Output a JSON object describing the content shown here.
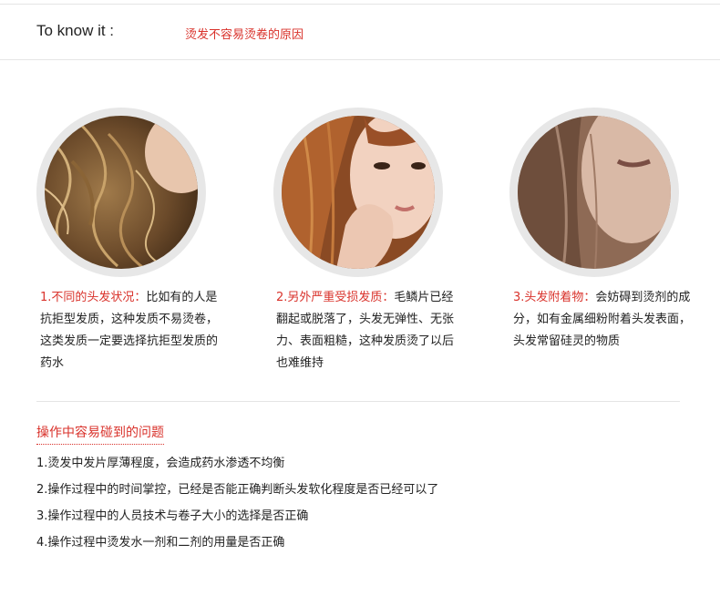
{
  "header": {
    "label": "To know it :",
    "subtitle": "烫发不容易烫卷的原因"
  },
  "causes": [
    {
      "head": "1.不同的头发状况：",
      "body": "比如有的人是抗拒型发质，这种发质不易烫卷，这类发质一定要选择抗拒型发质的药水"
    },
    {
      "head": "2.另外严重受损发质：",
      "body": "毛鳞片已经翻起或脱落了，头发无弹性、无张力、表面粗糙，这种发质烫了以后也难维持"
    },
    {
      "head": "3.头发附着物：",
      "body": "会妨碍到烫剂的成分，如有金属细粉附着头发表面，头发常留硅灵的物质"
    }
  ],
  "problems": {
    "title": "操作中容易碰到的问题",
    "items": [
      "1.烫发中发片厚薄程度，会造成药水渗透不均衡",
      "2.操作过程中的时间掌控，已经是否能正确判断头发软化程度是否已经可以了",
      "3.操作过程中的人员技术与卷子大小的选择是否正确",
      "4.操作过程中烫发水一剂和二剂的用量是否正确"
    ]
  },
  "colors": {
    "accent": "#d9322b",
    "text": "#222222",
    "ring": "#e7e7e7"
  }
}
